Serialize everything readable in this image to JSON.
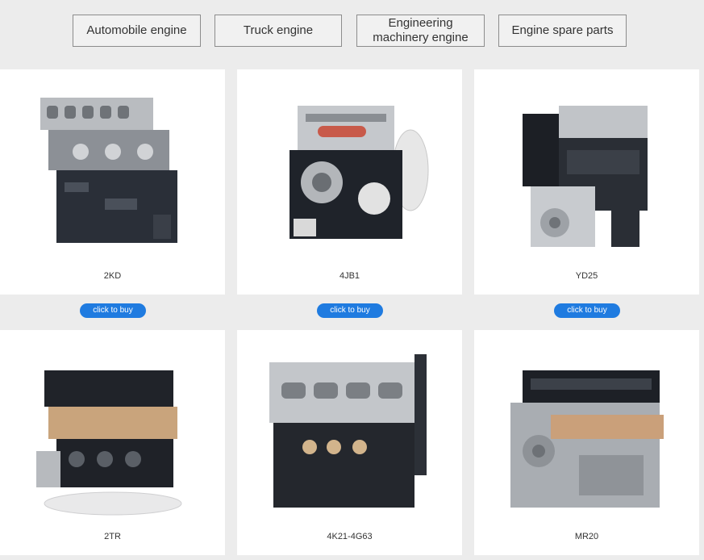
{
  "categories": [
    "Automobile engine",
    "Truck engine",
    "Engineering\nmachinery engine",
    "Engine spare parts"
  ],
  "products": [
    {
      "name": "2KD"
    },
    {
      "name": "4JB1"
    },
    {
      "name": "YD25"
    },
    {
      "name": "2TR"
    },
    {
      "name": "4K21-4G63"
    },
    {
      "name": "MR20"
    }
  ],
  "buy_label": "click to buy",
  "colors": {
    "page_bg": "#ececec",
    "card_bg": "#ffffff",
    "button_blue": "#1f7be0",
    "tab_border": "#8c8c8c"
  }
}
